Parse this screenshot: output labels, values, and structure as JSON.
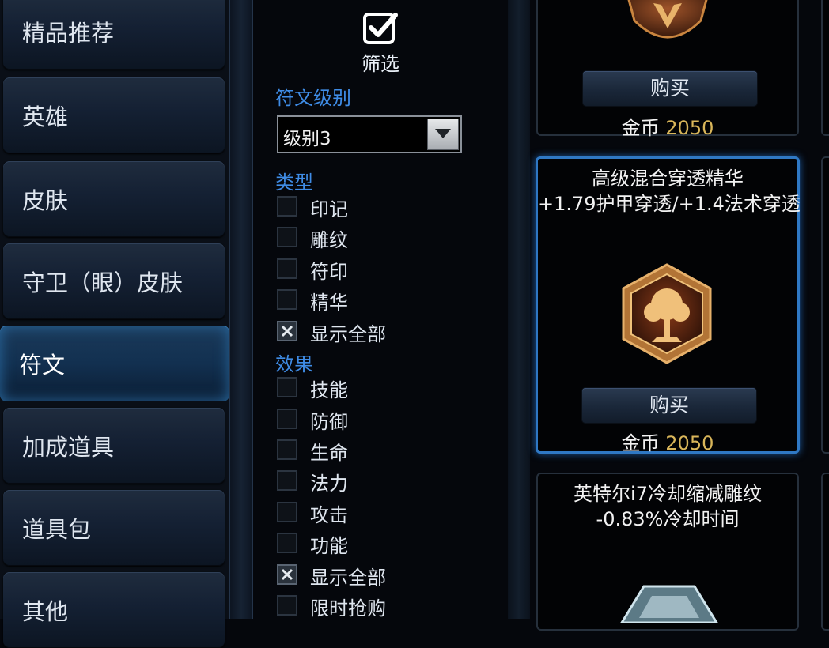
{
  "sidebar": {
    "items": [
      {
        "label": "精品推荐"
      },
      {
        "label": "英雄"
      },
      {
        "label": "皮肤"
      },
      {
        "label": "守卫（眼）皮肤"
      },
      {
        "label": "符文",
        "active": true
      },
      {
        "label": "加成道具"
      },
      {
        "label": "道具包"
      },
      {
        "label": "其他"
      }
    ]
  },
  "filter": {
    "title": "筛选",
    "icon": "checkbox-filter-icon",
    "rune_level": {
      "label": "符文级别",
      "selected": "级别3"
    },
    "type": {
      "label": "类型",
      "options": [
        {
          "label": "印记",
          "checked": false
        },
        {
          "label": "雕纹",
          "checked": false
        },
        {
          "label": "符印",
          "checked": false
        },
        {
          "label": "精华",
          "checked": false
        },
        {
          "label": "显示全部",
          "checked": true
        }
      ]
    },
    "effect": {
      "label": "效果",
      "options": [
        {
          "label": "技能",
          "checked": false
        },
        {
          "label": "防御",
          "checked": false
        },
        {
          "label": "生命",
          "checked": false
        },
        {
          "label": "法力",
          "checked": false
        },
        {
          "label": "攻击",
          "checked": false
        },
        {
          "label": "功能",
          "checked": false
        },
        {
          "label": "显示全部",
          "checked": true
        },
        {
          "label": "限时抢购",
          "checked": false
        }
      ]
    }
  },
  "items": [
    {
      "buy_label": "购买",
      "currency": "金币",
      "price": "2050"
    },
    {
      "name": "高级混合穿透精华",
      "desc": "+1.79护甲穿透/+1.4法术穿透",
      "buy_label": "购买",
      "currency": "金币",
      "price": "2050",
      "selected": true
    },
    {
      "name": "英特尔i7冷却缩减雕纹",
      "desc": "-0.83%冷却时间"
    }
  ],
  "colors": {
    "accent": "#3f8ce6",
    "gold": "#d9b65a",
    "selected_border": "#2f78c4"
  }
}
